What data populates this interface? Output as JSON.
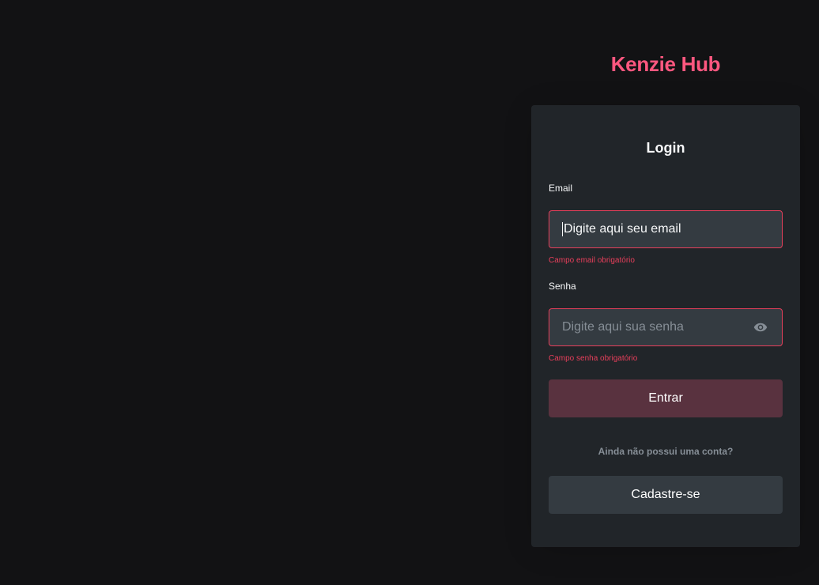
{
  "brand": {
    "logo_text": "Kenzie Hub"
  },
  "login": {
    "title": "Login",
    "email": {
      "label": "Email",
      "placeholder": "Digite aqui seu email",
      "value": "",
      "error": "Campo email obrigatório"
    },
    "password": {
      "label": "Senha",
      "placeholder": "Digite aqui sua senha",
      "value": "",
      "error": "Campo senha obrigatório",
      "toggle_icon": "eye-icon"
    },
    "submit_label": "Entrar",
    "signup_hint": "Ainda não possui uma conta?",
    "signup_label": "Cadastre-se"
  },
  "colors": {
    "background": "#121214",
    "card": "#212529",
    "brand": "#ff577f",
    "error": "#e83f5b",
    "primary_disabled": "#59323f",
    "input_bg": "#343b41",
    "muted_text": "#868e96"
  }
}
